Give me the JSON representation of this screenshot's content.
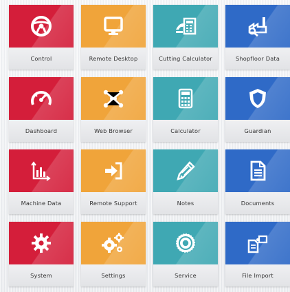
{
  "tiles": [
    {
      "label": "Control",
      "color": "#d41e3a",
      "icon": "steering-wheel-icon"
    },
    {
      "label": "Remote Desktop",
      "color": "#f0a43a",
      "icon": "monitor-icon"
    },
    {
      "label": "Cutting Calculator",
      "color": "#3fa8b3",
      "icon": "cutting-calculator-icon"
    },
    {
      "label": "Shopfloor Data",
      "color": "#2f6ac7",
      "icon": "factory-icon"
    },
    {
      "label": "Dashboard",
      "color": "#d41e3a",
      "icon": "gauge-icon"
    },
    {
      "label": "Web Browser",
      "color": "#f0a43a",
      "icon": "network-icon"
    },
    {
      "label": "Calculator",
      "color": "#3fa8b3",
      "icon": "calculator-icon"
    },
    {
      "label": "Guardian",
      "color": "#2f6ac7",
      "icon": "shield-icon"
    },
    {
      "label": "Machine Data",
      "color": "#d41e3a",
      "icon": "bar-chart-icon"
    },
    {
      "label": "Remote Support",
      "color": "#f0a43a",
      "icon": "sign-in-icon"
    },
    {
      "label": "Notes",
      "color": "#3fa8b3",
      "icon": "pencil-icon"
    },
    {
      "label": "Documents",
      "color": "#2f6ac7",
      "icon": "document-icon"
    },
    {
      "label": "System",
      "color": "#d41e3a",
      "icon": "gear-icon"
    },
    {
      "label": "Settings",
      "color": "#f0a43a",
      "icon": "gears-icon"
    },
    {
      "label": "Service",
      "color": "#3fa8b3",
      "icon": "cog-wheel-icon"
    },
    {
      "label": "File Import",
      "color": "#2f6ac7",
      "icon": "file-import-icon"
    }
  ]
}
